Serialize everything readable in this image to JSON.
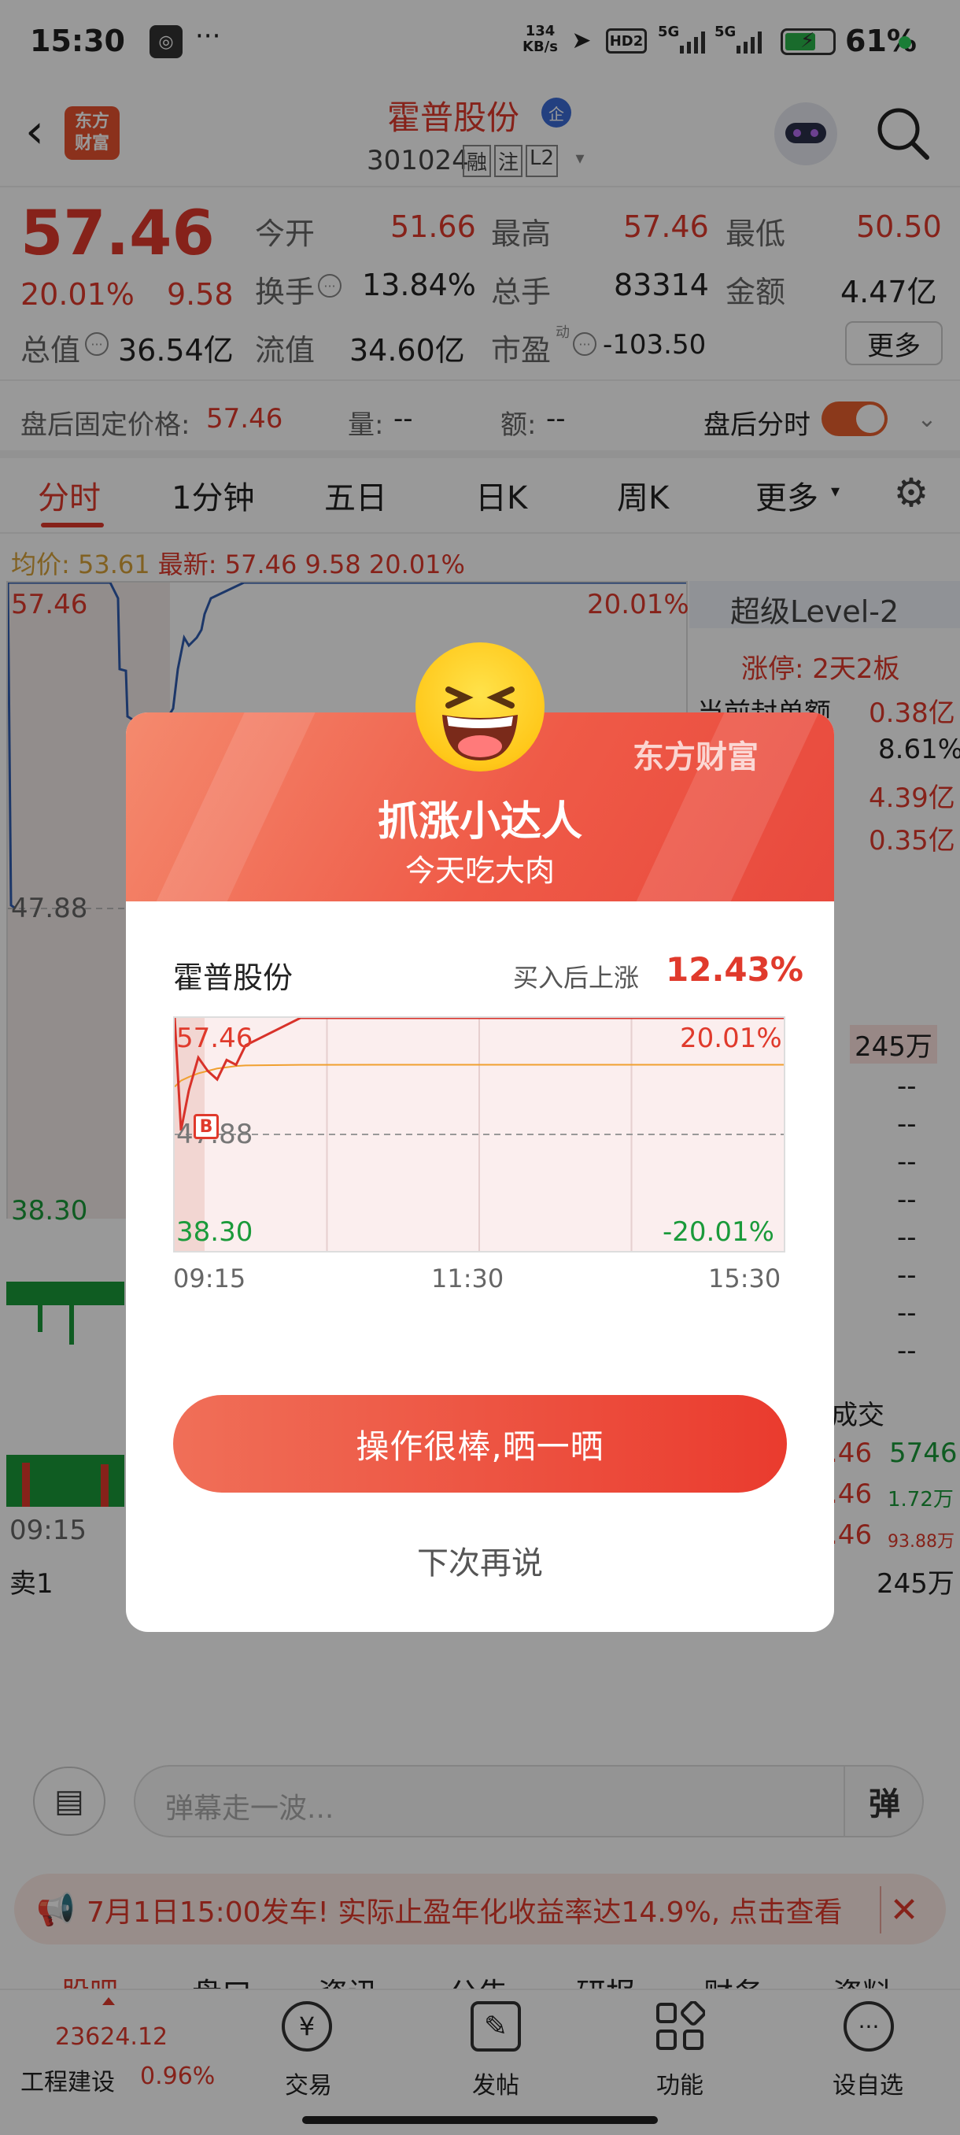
{
  "status_bar": {
    "time": "15:30",
    "more": "···",
    "net_speed_top": "134",
    "net_speed_bottom": "KB/s",
    "hd": "HD2",
    "sig1": "5G",
    "sig2": "5G",
    "battery": "61%"
  },
  "header": {
    "logo_line1": "东方",
    "logo_line2": "财富",
    "stock_name": "霍普股份",
    "stock_code": "301024",
    "tag1": "融",
    "tag2": "注",
    "tag3": "L2"
  },
  "quote": {
    "price": "57.46",
    "change_pct": "20.01%",
    "change": "9.58",
    "open_label": "今开",
    "open": "51.66",
    "high_label": "最高",
    "high": "57.46",
    "low_label": "最低",
    "low": "50.50",
    "turnover_label": "换手",
    "turnover": "13.84%",
    "volume_label": "总手",
    "volume": "83314",
    "amount_label": "金额",
    "amount": "4.47亿",
    "mktcap_label": "总值",
    "mktcap": "36.54亿",
    "float_label": "流值",
    "float": "34.60亿",
    "pe_label": "市盈",
    "pe_sup": "动",
    "pe": "-103.50",
    "more_button": "更多"
  },
  "after_hours": {
    "price_label": "盘后固定价格:",
    "price": "57.46",
    "vol_label": "量:",
    "vol": "--",
    "amt_label": "额:",
    "amt": "--",
    "toggle_label": "盘后分时"
  },
  "tabs": [
    {
      "label": "分时"
    },
    {
      "label": "1分钟"
    },
    {
      "label": "五日"
    },
    {
      "label": "日K"
    },
    {
      "label": "周K"
    },
    {
      "label": "更多"
    }
  ],
  "chart_info": {
    "avg_label": "均价:",
    "avg": "53.61",
    "last_label": "最新:",
    "last": "57.46",
    "chg": "9.58",
    "pct": "20.01%"
  },
  "main_chart": {
    "top": "57.46",
    "mid": "47.88",
    "bottom": "38.30",
    "pct_top": "20.01%",
    "time_start": "09:15",
    "sell1": "卖1"
  },
  "level2": {
    "title": "超级Level-2",
    "limit_info": "涨停: 2天2板",
    "seal_label": "当前封单额",
    "seal": "0.38亿",
    "r2": "8.61%",
    "r3": "4.39亿",
    "r4": "0.35亿",
    "order_vol": "245万",
    "dash": "--",
    "deal_label": "成交",
    "deal_price": ".46",
    "v1": "5746",
    "v2": "1.72万",
    "v3": "93.88万",
    "sell1_vol": "245万"
  },
  "comment": {
    "placeholder": "弹幕走一波...",
    "send": "弹"
  },
  "banner": {
    "text": "7月1日15:00发车! 实际止盈年化收益率达14.9%, 点击查看"
  },
  "under_tabs": [
    "股吧",
    "盘口",
    "资讯",
    "公告",
    "研报",
    "财务",
    "资料"
  ],
  "bottom_nav": {
    "index_value": "23624.12",
    "index_name": "工程建设",
    "index_pct": "0.96%",
    "trade": "交易",
    "post": "发帖",
    "func": "功能",
    "watch": "设自选"
  },
  "modal": {
    "brand": "东方财富",
    "title": "抓涨小达人",
    "subtitle": "今天吃大肉",
    "stock": "霍普股份",
    "gain_label": "买入后上涨",
    "gain": "12.43%",
    "chart_top": "57.46",
    "chart_mid": "47.88",
    "chart_bottom": "38.30",
    "pct_top": "20.01%",
    "pct_bottom": "-20.01%",
    "t1": "09:15",
    "t2": "11:30",
    "t3": "15:30",
    "buy_marker": "B",
    "cta": "操作很棒,晒一晒",
    "later": "下次再说"
  },
  "chart_data": {
    "type": "line",
    "title": "",
    "x_start": "09:15",
    "x_mid": "11:30",
    "x_end": "15:30",
    "ylim": [
      38.3,
      57.46
    ],
    "pct_range": [
      "-20.01%",
      "20.01%"
    ],
    "series": [
      {
        "price": [
          57.46,
          48.2,
          51.5,
          54.2,
          53.1,
          52.4,
          54.0,
          53.6,
          55.2,
          57.46,
          57.46,
          57.46,
          57.46,
          57.46,
          57.46
        ]
      },
      {
        "average": [
          51.8,
          52.3,
          52.6,
          52.9,
          53.1,
          53.3,
          53.4,
          53.5,
          53.55,
          53.6,
          53.61,
          53.61,
          53.61,
          53.61,
          53.61
        ]
      }
    ],
    "buy_price": 48.4
  }
}
